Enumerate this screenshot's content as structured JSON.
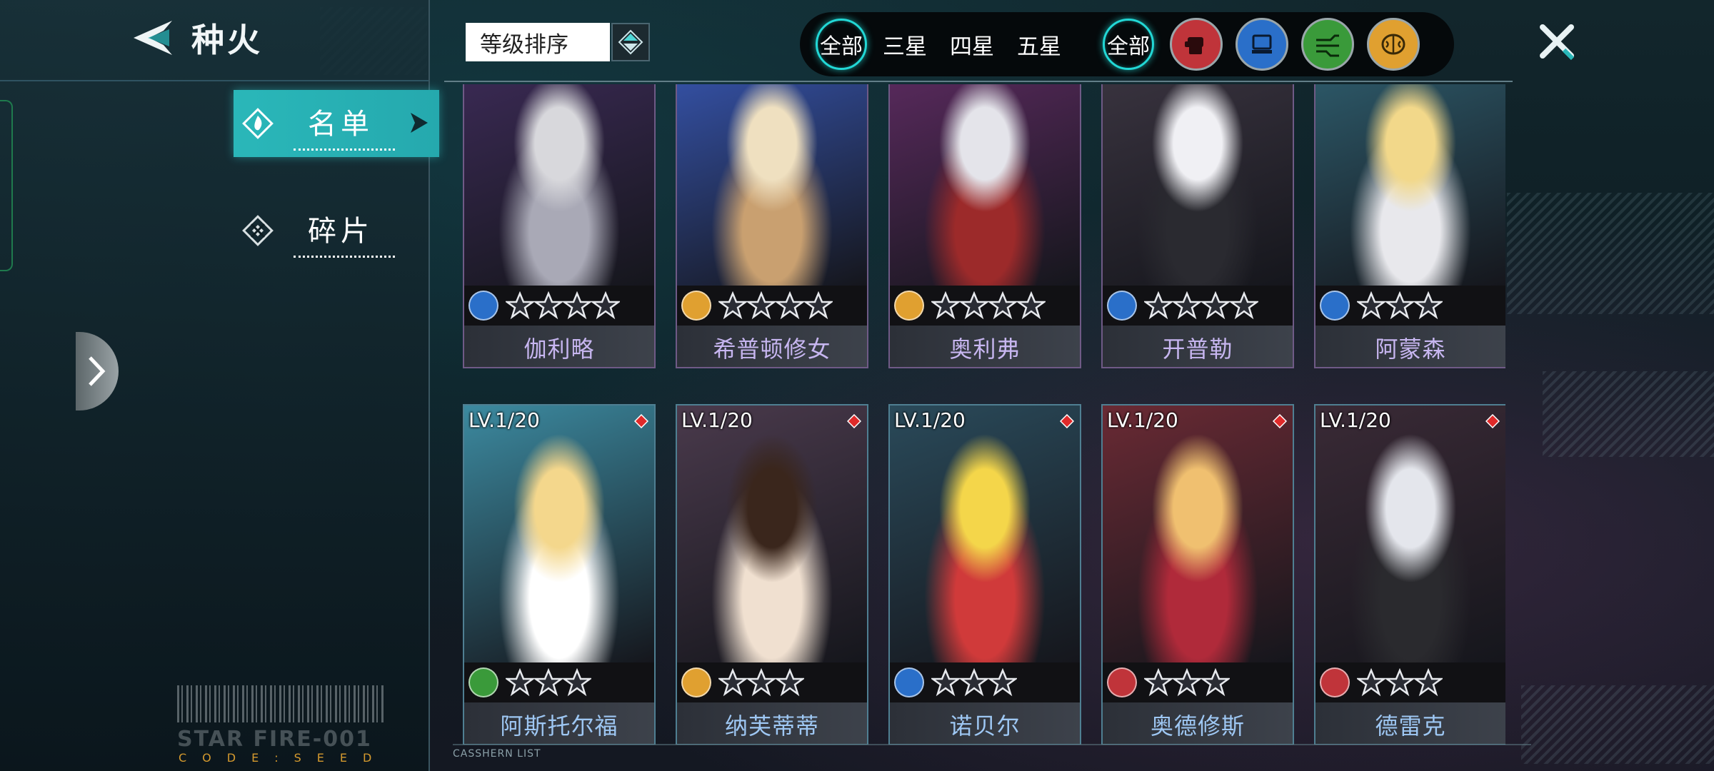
{
  "header": {
    "title": "种火"
  },
  "sidebar": {
    "tabs": [
      {
        "label": "名单",
        "active": true
      },
      {
        "label": "碎片",
        "active": false
      }
    ],
    "brand_text": "STAR FIRE-001",
    "code_text": "CODE:SEED"
  },
  "sort": {
    "label": "等级排序"
  },
  "filters": {
    "rarity": [
      {
        "label": "全部",
        "active": true
      },
      {
        "label": "三星",
        "active": false
      },
      {
        "label": "四星",
        "active": false
      },
      {
        "label": "五星",
        "active": false
      }
    ],
    "type_all": {
      "label": "全部",
      "active": true
    },
    "types": [
      {
        "icon": "fist-icon",
        "color": "#c0343a"
      },
      {
        "icon": "chip-icon",
        "color": "#2a6fc9"
      },
      {
        "icon": "circuit-icon",
        "color": "#3a9a3a"
      },
      {
        "icon": "brain-icon",
        "color": "#e0a030"
      }
    ]
  },
  "cards": [
    {
      "name": "伽利略",
      "stars": 4,
      "type_icon": "chip-icon",
      "type_color": "#2a6fc9",
      "palette": [
        "#3b2a55",
        "#d8d8dc",
        "#a9a9b6"
      ]
    },
    {
      "name": "希普顿修女",
      "stars": 4,
      "type_icon": "brain-icon",
      "type_color": "#e0a030",
      "palette": [
        "#3552a8",
        "#efe0c0",
        "#c9a070"
      ]
    },
    {
      "name": "奥利弗",
      "stars": 4,
      "type_icon": "brain-icon",
      "type_color": "#e0a030",
      "palette": [
        "#5a2a5e",
        "#e4e4ea",
        "#9c2a2a"
      ]
    },
    {
      "name": "开普勒",
      "stars": 4,
      "type_icon": "chip-icon",
      "type_color": "#2a6fc9",
      "palette": [
        "#3a3440",
        "#f0f0f4",
        "#2a2a30"
      ]
    },
    {
      "name": "阿蒙森",
      "stars": 3,
      "type_icon": "chip-icon",
      "type_color": "#2a6fc9",
      "palette": [
        "#2d5a6a",
        "#f2d88a",
        "#e8e8ec"
      ]
    },
    {
      "name": "阿斯托尔福",
      "level": "LV.1/20",
      "stars": 3,
      "type_icon": "circuit-icon",
      "type_color": "#3a9a3a",
      "palette": [
        "#3c8aa0",
        "#f4d78c",
        "#ffffff"
      ]
    },
    {
      "name": "纳芙蒂蒂",
      "level": "LV.1/20",
      "stars": 3,
      "type_icon": "brain-icon",
      "type_color": "#e0a030",
      "palette": [
        "#4a3a4c",
        "#3a261c",
        "#f0e0d0"
      ]
    },
    {
      "name": "诺贝尔",
      "level": "LV.1/20",
      "stars": 3,
      "type_icon": "chip-icon",
      "type_color": "#2a6fc9",
      "palette": [
        "#2a4a5a",
        "#f4d64a",
        "#d03a3a"
      ]
    },
    {
      "name": "奥德修斯",
      "level": "LV.1/20",
      "stars": 3,
      "type_icon": "fist-icon",
      "type_color": "#c0343a",
      "palette": [
        "#6a2a34",
        "#f0c070",
        "#b02a3a"
      ]
    },
    {
      "name": "德雷克",
      "level": "LV.1/20",
      "stars": 3,
      "type_icon": "fist-icon",
      "type_color": "#c0343a",
      "palette": [
        "#3a2a36",
        "#e4e6ec",
        "#2a2a2e"
      ]
    }
  ],
  "footer": {
    "caption": "CASSHERN LIST"
  }
}
